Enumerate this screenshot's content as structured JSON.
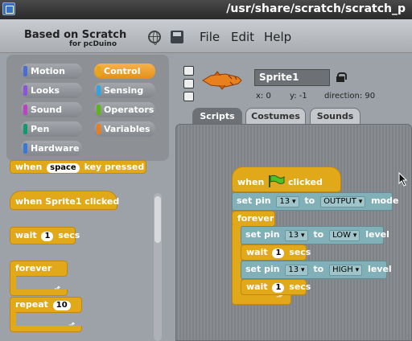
{
  "window": {
    "title": "/usr/share/scratch/scratch_p"
  },
  "menubar": {
    "logo": "Based on Scratch",
    "logo_sub": "for pcDuino",
    "items": [
      "File",
      "Edit",
      "Help"
    ]
  },
  "categories": [
    {
      "label": "Motion",
      "color": "#4a6cd4"
    },
    {
      "label": "Control",
      "color": "#e1a91a"
    },
    {
      "label": "Looks",
      "color": "#8a55d7"
    },
    {
      "label": "Sensing",
      "color": "#2ca5e2"
    },
    {
      "label": "Sound",
      "color": "#bb42c3"
    },
    {
      "label": "Operators",
      "color": "#5cb712"
    },
    {
      "label": "Pen",
      "color": "#0e9a6c"
    },
    {
      "label": "Variables",
      "color": "#ee7d16"
    },
    {
      "label": "Hardware",
      "color": "#3a78d8"
    }
  ],
  "palette": {
    "partial_block": {
      "prefix": "when",
      "key": "space",
      "suffix": "key pressed"
    },
    "when_clicked": "when Sprite1 clicked",
    "wait": {
      "label": "wait",
      "value": "1",
      "unit": "secs"
    },
    "forever": "forever",
    "repeat": {
      "label": "repeat",
      "value": "10"
    }
  },
  "sprite": {
    "name": "Sprite1",
    "x_label": "x:",
    "x": "0",
    "y_label": "y:",
    "y": "-1",
    "direction_label": "direction:",
    "direction": "90"
  },
  "tabs": [
    "Scripts",
    "Costumes",
    "Sounds"
  ],
  "script": {
    "hat": {
      "prefix": "when",
      "suffix": "clicked"
    },
    "setpin1": {
      "label": "set pin",
      "pin": "13",
      "to": "to",
      "value": "OUTPUT",
      "suffix": "mode"
    },
    "forever": "forever",
    "setpin2": {
      "label": "set pin",
      "pin": "13",
      "to": "to",
      "value": "LOW",
      "suffix": "level"
    },
    "wait1": {
      "label": "wait",
      "value": "1",
      "unit": "secs"
    },
    "setpin3": {
      "label": "set pin",
      "pin": "13",
      "to": "to",
      "value": "HIGH",
      "suffix": "level"
    },
    "wait2": {
      "label": "wait",
      "value": "1",
      "unit": "secs"
    }
  }
}
